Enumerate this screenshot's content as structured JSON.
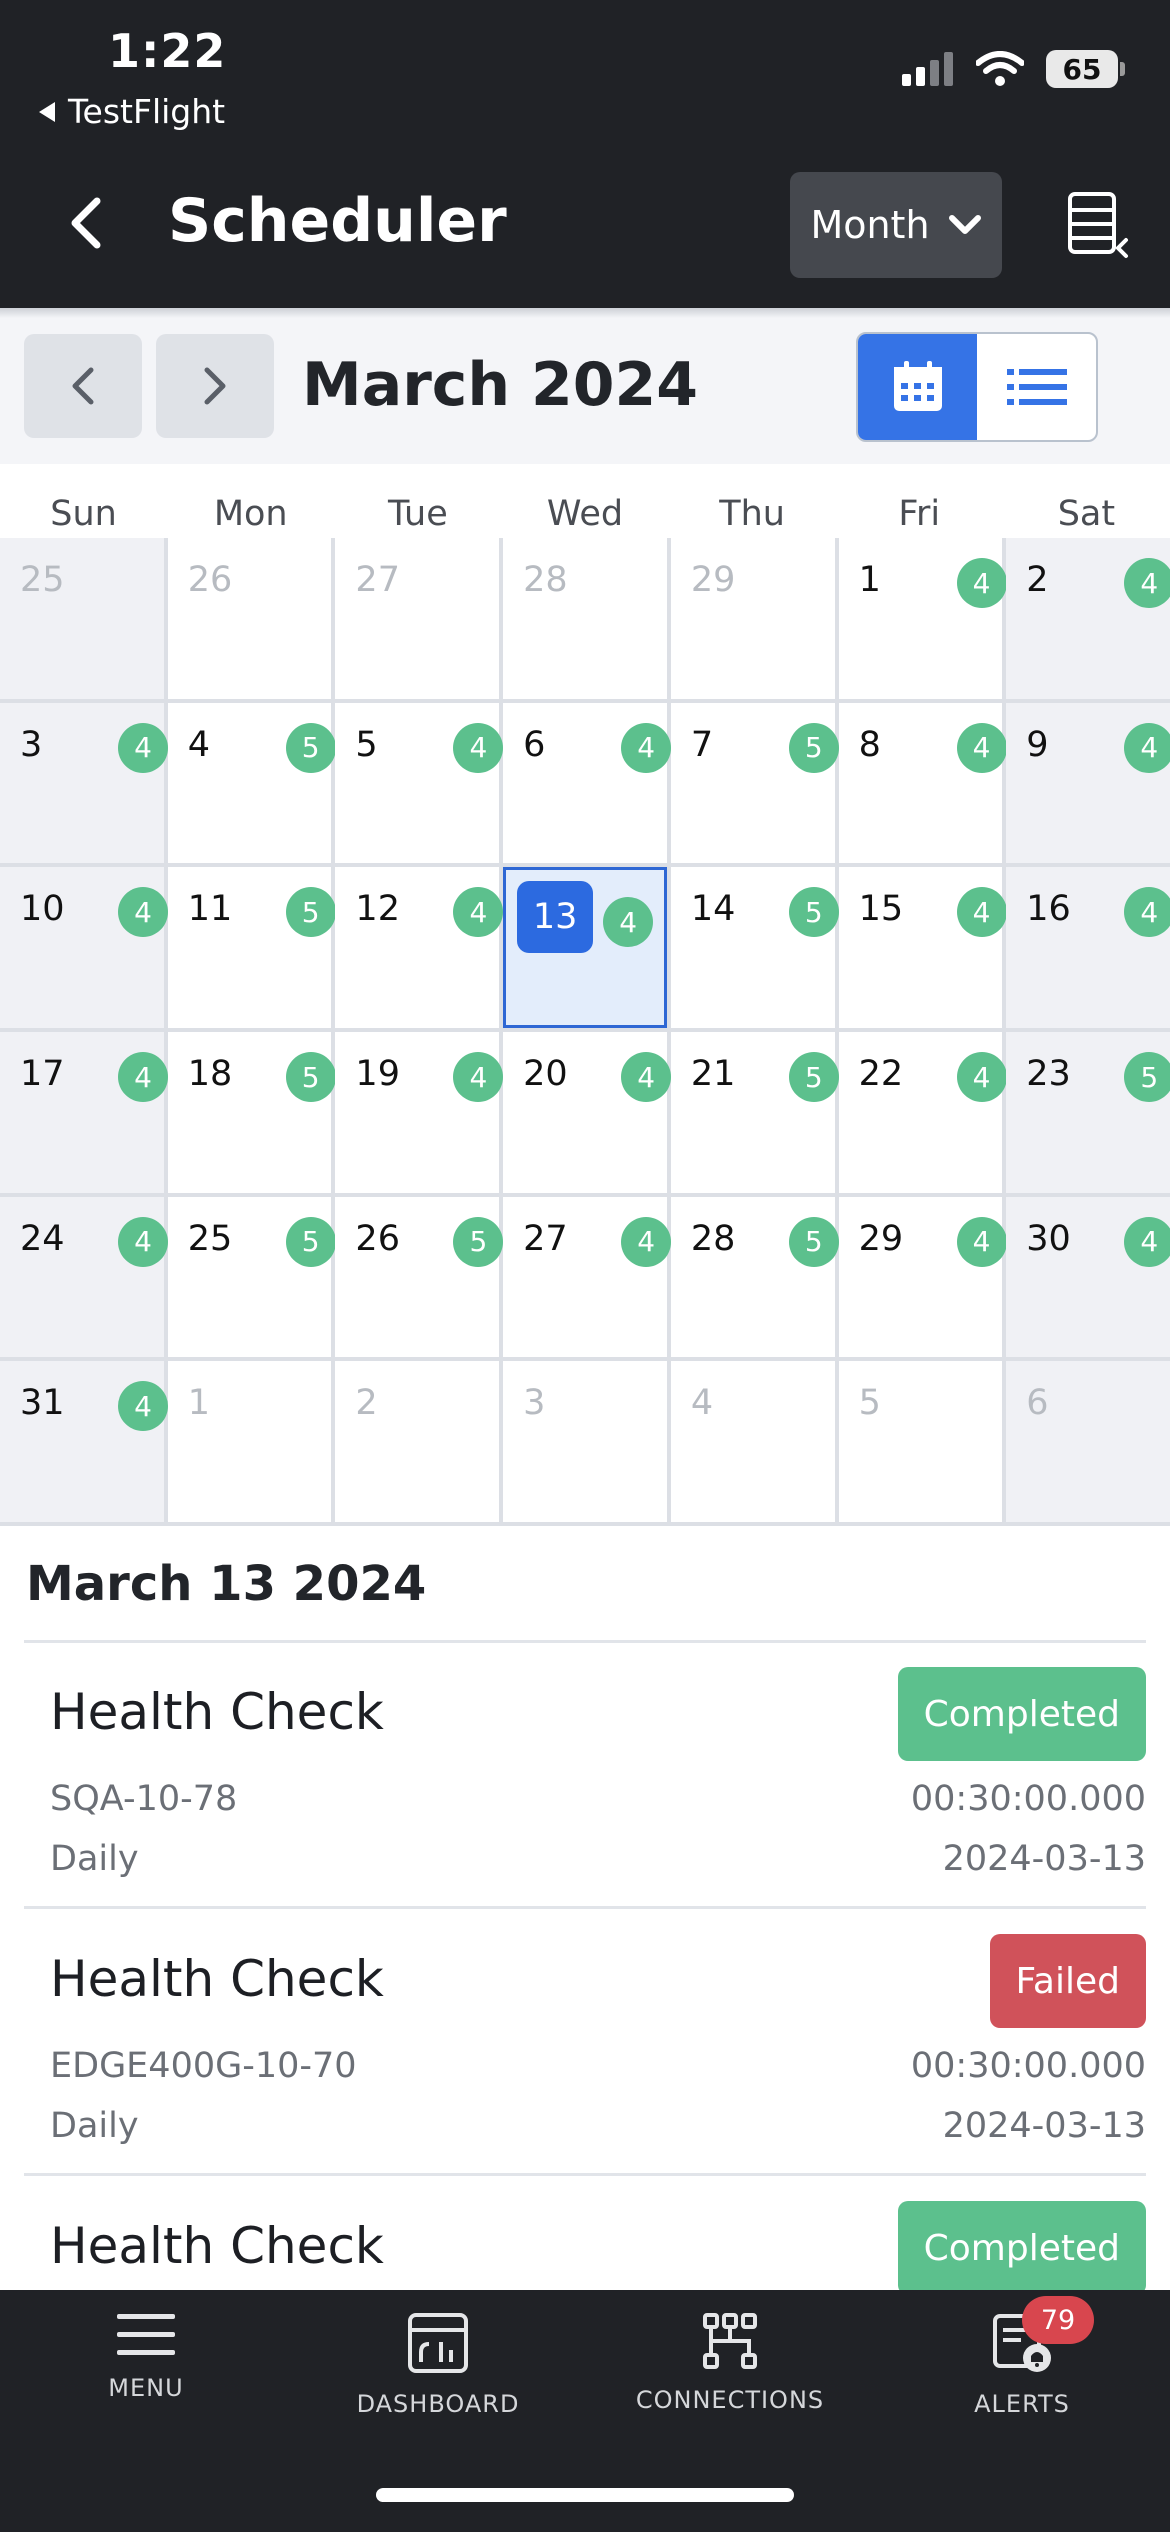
{
  "status_bar": {
    "time": "1:22",
    "back_app": "TestFlight",
    "battery": "65"
  },
  "header": {
    "title": "Scheduler",
    "view_mode": "Month"
  },
  "toolbar": {
    "month_label": "March 2024"
  },
  "weekdays": [
    "Sun",
    "Mon",
    "Tue",
    "Wed",
    "Thu",
    "Fri",
    "Sat"
  ],
  "calendar": {
    "cells": [
      {
        "day": "25",
        "count": "",
        "muted": true
      },
      {
        "day": "26",
        "count": "",
        "muted": true
      },
      {
        "day": "27",
        "count": "",
        "muted": true
      },
      {
        "day": "28",
        "count": "",
        "muted": true
      },
      {
        "day": "29",
        "count": "",
        "muted": true
      },
      {
        "day": "1",
        "count": "4",
        "muted": false
      },
      {
        "day": "2",
        "count": "4",
        "muted": false
      },
      {
        "day": "3",
        "count": "4",
        "muted": false
      },
      {
        "day": "4",
        "count": "5",
        "muted": false
      },
      {
        "day": "5",
        "count": "4",
        "muted": false
      },
      {
        "day": "6",
        "count": "4",
        "muted": false
      },
      {
        "day": "7",
        "count": "5",
        "muted": false
      },
      {
        "day": "8",
        "count": "4",
        "muted": false
      },
      {
        "day": "9",
        "count": "4",
        "muted": false
      },
      {
        "day": "10",
        "count": "4",
        "muted": false
      },
      {
        "day": "11",
        "count": "5",
        "muted": false
      },
      {
        "day": "12",
        "count": "4",
        "muted": false
      },
      {
        "day": "13",
        "count": "4",
        "muted": false,
        "selected": true
      },
      {
        "day": "14",
        "count": "5",
        "muted": false
      },
      {
        "day": "15",
        "count": "4",
        "muted": false
      },
      {
        "day": "16",
        "count": "4",
        "muted": false
      },
      {
        "day": "17",
        "count": "4",
        "muted": false
      },
      {
        "day": "18",
        "count": "5",
        "muted": false
      },
      {
        "day": "19",
        "count": "4",
        "muted": false
      },
      {
        "day": "20",
        "count": "4",
        "muted": false
      },
      {
        "day": "21",
        "count": "5",
        "muted": false
      },
      {
        "day": "22",
        "count": "4",
        "muted": false
      },
      {
        "day": "23",
        "count": "5",
        "muted": false
      },
      {
        "day": "24",
        "count": "4",
        "muted": false
      },
      {
        "day": "25",
        "count": "5",
        "muted": false
      },
      {
        "day": "26",
        "count": "5",
        "muted": false
      },
      {
        "day": "27",
        "count": "4",
        "muted": false
      },
      {
        "day": "28",
        "count": "5",
        "muted": false
      },
      {
        "day": "29",
        "count": "4",
        "muted": false
      },
      {
        "day": "30",
        "count": "4",
        "muted": false
      },
      {
        "day": "31",
        "count": "4",
        "muted": false
      },
      {
        "day": "1",
        "count": "",
        "muted": true
      },
      {
        "day": "2",
        "count": "",
        "muted": true
      },
      {
        "day": "3",
        "count": "",
        "muted": true
      },
      {
        "day": "4",
        "count": "",
        "muted": true
      },
      {
        "day": "5",
        "count": "",
        "muted": true
      },
      {
        "day": "6",
        "count": "",
        "muted": true
      }
    ]
  },
  "details": {
    "title": "March 13 2024",
    "events": [
      {
        "name": "Health Check",
        "status": "Completed",
        "device": "SQA-10-78",
        "duration": "00:30:00.000",
        "frequency": "Daily",
        "date": "2024-03-13"
      },
      {
        "name": "Health Check",
        "status": "Failed",
        "device": "EDGE400G-10-70",
        "duration": "00:30:00.000",
        "frequency": "Daily",
        "date": "2024-03-13"
      },
      {
        "name": "Health Check",
        "status": "Completed",
        "device": "",
        "duration": "",
        "frequency": "",
        "date": ""
      }
    ]
  },
  "tabbar": {
    "items": [
      {
        "label": "MENU",
        "icon": "menu-icon"
      },
      {
        "label": "DASHBOARD",
        "icon": "dashboard-icon"
      },
      {
        "label": "CONNECTIONS",
        "icon": "connections-icon"
      },
      {
        "label": "ALERTS",
        "icon": "alerts-icon"
      }
    ],
    "alerts_count": "79"
  },
  "colors": {
    "header_bg": "#202226",
    "accent_blue": "#2c6ae0",
    "count_badge": "#5cc08d",
    "status_completed": "#5cc08d",
    "status_failed": "#d0525a",
    "alert_badge": "#d8464e"
  }
}
